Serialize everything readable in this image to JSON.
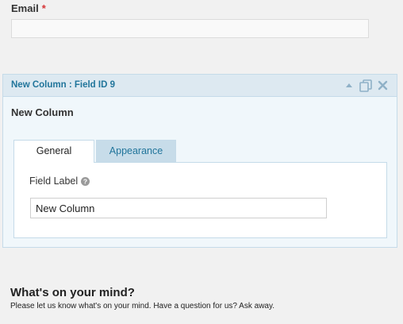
{
  "email_field": {
    "label": "Email",
    "required_marker": "*",
    "value": ""
  },
  "field_panel": {
    "header_title": "New Column : Field ID 9",
    "header_icons": [
      "collapse-up-icon",
      "duplicate-icon",
      "delete-icon"
    ],
    "field_name": "New Column",
    "tabs": [
      {
        "label": "General",
        "active": true
      },
      {
        "label": "Appearance",
        "active": false
      }
    ],
    "general": {
      "field_label_caption": "Field Label",
      "help_icon": "help-icon",
      "field_label_value": "New Column"
    }
  },
  "section": {
    "title": "What's on your mind?",
    "description": "Please let us know what's on your mind. Have a question for us? Ask away."
  },
  "colors": {
    "accent_blue": "#21759b",
    "panel_bg": "#f0f7fb",
    "header_bg": "#dde9f1",
    "required_red": "#d63638"
  }
}
